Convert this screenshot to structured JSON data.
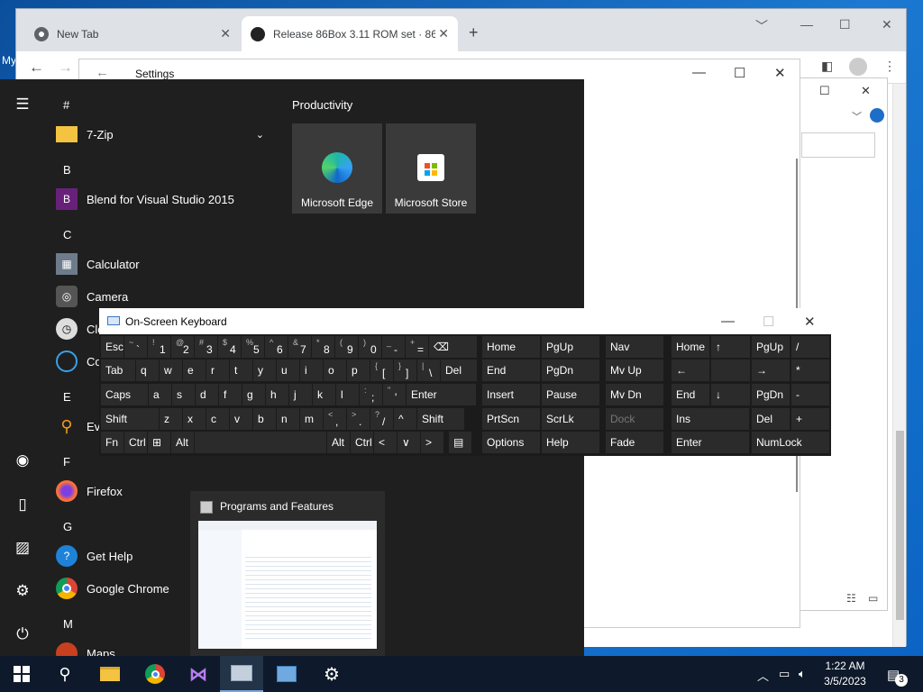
{
  "desktop": {
    "icon_label": "My"
  },
  "browser": {
    "tabs": [
      {
        "label": "New Tab"
      },
      {
        "label": "Release 86Box 3.11 ROM set · 86"
      }
    ],
    "new_tab_symbol": "+",
    "close_symbol": "✕",
    "minimize_symbol": "—",
    "maximize_symbol": "☐",
    "restore_symbol": "﹀"
  },
  "settings_window": {
    "title": "Settings"
  },
  "start_menu": {
    "groups": [
      {
        "header": "#",
        "apps": [
          {
            "label": "7-Zip",
            "icon": "folder-icon"
          }
        ]
      },
      {
        "header": "B",
        "apps": [
          {
            "label": "Blend for Visual Studio 2015",
            "icon": "blend-icon"
          }
        ]
      },
      {
        "header": "C",
        "apps": [
          {
            "label": "Calculator",
            "icon": "calculator-icon"
          },
          {
            "label": "Camera",
            "icon": "camera-icon"
          },
          {
            "label": "Clo",
            "icon": "clock-icon"
          },
          {
            "label": "Co",
            "icon": "cortana-icon"
          }
        ]
      },
      {
        "header": "E",
        "apps": [
          {
            "label": "Ev",
            "icon": "search-icon"
          }
        ]
      },
      {
        "header": "F",
        "apps": [
          {
            "label": "Firefox",
            "icon": "firefox-icon"
          }
        ]
      },
      {
        "header": "G",
        "apps": [
          {
            "label": "Get Help",
            "icon": "help-icon"
          },
          {
            "label": "Google Chrome",
            "icon": "chrome-icon"
          }
        ]
      },
      {
        "header": "M",
        "apps": [
          {
            "label": "Maps",
            "icon": "maps-icon"
          }
        ]
      }
    ],
    "tiles_title": "Productivity",
    "tiles": [
      {
        "label": "Microsoft Edge"
      },
      {
        "label": "Microsoft Store"
      }
    ]
  },
  "thumbnail": {
    "title": "Programs and Features"
  },
  "osk": {
    "title": "On-Screen Keyboard",
    "row1": [
      {
        "main": "Esc"
      },
      {
        "sub": "~",
        "main": "`"
      },
      {
        "sub": "!",
        "main": "1"
      },
      {
        "sub": "@",
        "main": "2"
      },
      {
        "sub": "#",
        "main": "3"
      },
      {
        "sub": "$",
        "main": "4"
      },
      {
        "sub": "%",
        "main": "5"
      },
      {
        "sub": "^",
        "main": "6"
      },
      {
        "sub": "&",
        "main": "7"
      },
      {
        "sub": "*",
        "main": "8"
      },
      {
        "sub": "(",
        "main": "9"
      },
      {
        "sub": ")",
        "main": "0"
      },
      {
        "sub": "_",
        "main": "-"
      },
      {
        "sub": "+",
        "main": "="
      },
      {
        "main": "⌫"
      }
    ],
    "row2": [
      {
        "main": "Tab"
      },
      {
        "main": "q"
      },
      {
        "main": "w"
      },
      {
        "main": "e"
      },
      {
        "main": "r"
      },
      {
        "main": "t"
      },
      {
        "main": "y"
      },
      {
        "main": "u"
      },
      {
        "main": "i"
      },
      {
        "main": "o"
      },
      {
        "main": "p"
      },
      {
        "sub": "{",
        "main": "["
      },
      {
        "sub": "}",
        "main": "]"
      },
      {
        "sub": "|",
        "main": "\\"
      },
      {
        "main": "Del"
      }
    ],
    "row3": [
      {
        "main": "Caps"
      },
      {
        "main": "a"
      },
      {
        "main": "s"
      },
      {
        "main": "d"
      },
      {
        "main": "f"
      },
      {
        "main": "g"
      },
      {
        "main": "h"
      },
      {
        "main": "j"
      },
      {
        "main": "k"
      },
      {
        "main": "l"
      },
      {
        "sub": ":",
        "main": ";"
      },
      {
        "sub": "\"",
        "main": "'"
      },
      {
        "main": "Enter"
      }
    ],
    "row4": [
      {
        "main": "Shift"
      },
      {
        "main": "z"
      },
      {
        "main": "x"
      },
      {
        "main": "c"
      },
      {
        "main": "v"
      },
      {
        "main": "b"
      },
      {
        "main": "n"
      },
      {
        "main": "m"
      },
      {
        "sub": "<",
        "main": ","
      },
      {
        "sub": ">",
        "main": "."
      },
      {
        "sub": "?",
        "main": "/"
      },
      {
        "main": "^"
      },
      {
        "main": "Shift"
      }
    ],
    "row5": [
      {
        "main": "Fn"
      },
      {
        "main": "Ctrl"
      },
      {
        "main": "⊞"
      },
      {
        "main": "Alt"
      },
      {
        "main": ""
      },
      {
        "main": "Alt"
      },
      {
        "main": "Ctrl"
      },
      {
        "main": "<"
      },
      {
        "main": "∨"
      },
      {
        "main": ">"
      },
      {
        "main": "▤"
      }
    ],
    "nav": [
      [
        "Home",
        "PgUp",
        "Nav"
      ],
      [
        "End",
        "PgDn",
        "Mv Up"
      ],
      [
        "Insert",
        "Pause",
        "Mv Dn"
      ],
      [
        "PrtScn",
        "ScrLk",
        "Dock"
      ],
      [
        "Options",
        "Help",
        "Fade"
      ]
    ],
    "numpad": [
      [
        "Home",
        "↑",
        "PgUp",
        "/"
      ],
      [
        "←",
        "",
        "→",
        "*"
      ],
      [
        "End",
        "↓",
        "PgDn",
        "-"
      ],
      [
        "Ins",
        "",
        "Del",
        "+"
      ],
      [
        "Enter",
        "",
        "NumLock",
        ""
      ]
    ]
  },
  "taskbar": {
    "time": "1:22 AM",
    "date": "3/5/2023",
    "notification_count": "3"
  }
}
